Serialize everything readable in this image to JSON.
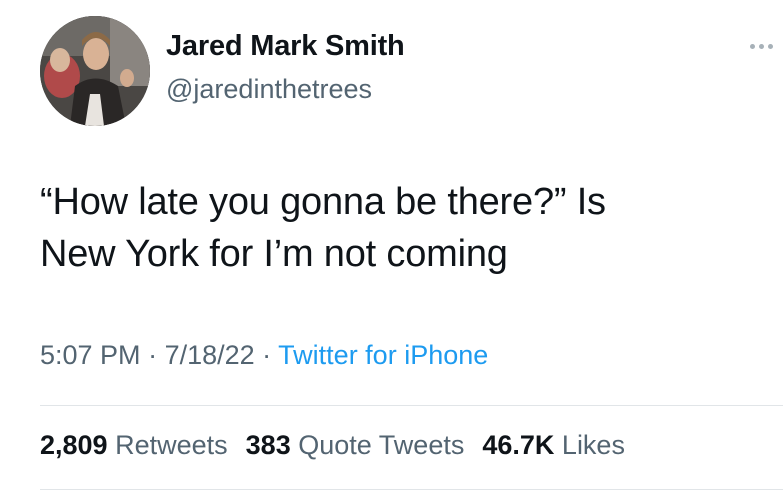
{
  "author": {
    "name": "Jared Mark Smith",
    "handle": "@jaredinthetrees"
  },
  "tweet": {
    "text_line1": "“How late you gonna be there?” Is",
    "text_line2": "New York for I’m not coming"
  },
  "meta": {
    "time": "5:07 PM",
    "sep1": " · ",
    "date": "7/18/22",
    "sep2": " · ",
    "source": "Twitter for iPhone"
  },
  "stats": {
    "retweets_count": "2,809",
    "retweets_label": "Retweets",
    "quotes_count": "383",
    "quotes_label": "Quote Tweets",
    "likes_count": "46.7K",
    "likes_label": "Likes"
  },
  "icons": {
    "more": "more-options-icon",
    "avatar": "profile-photo"
  },
  "colors": {
    "text": "#0f1419",
    "secondary": "#536471",
    "link": "#1d9bf0",
    "divider": "#e1e5e8"
  }
}
